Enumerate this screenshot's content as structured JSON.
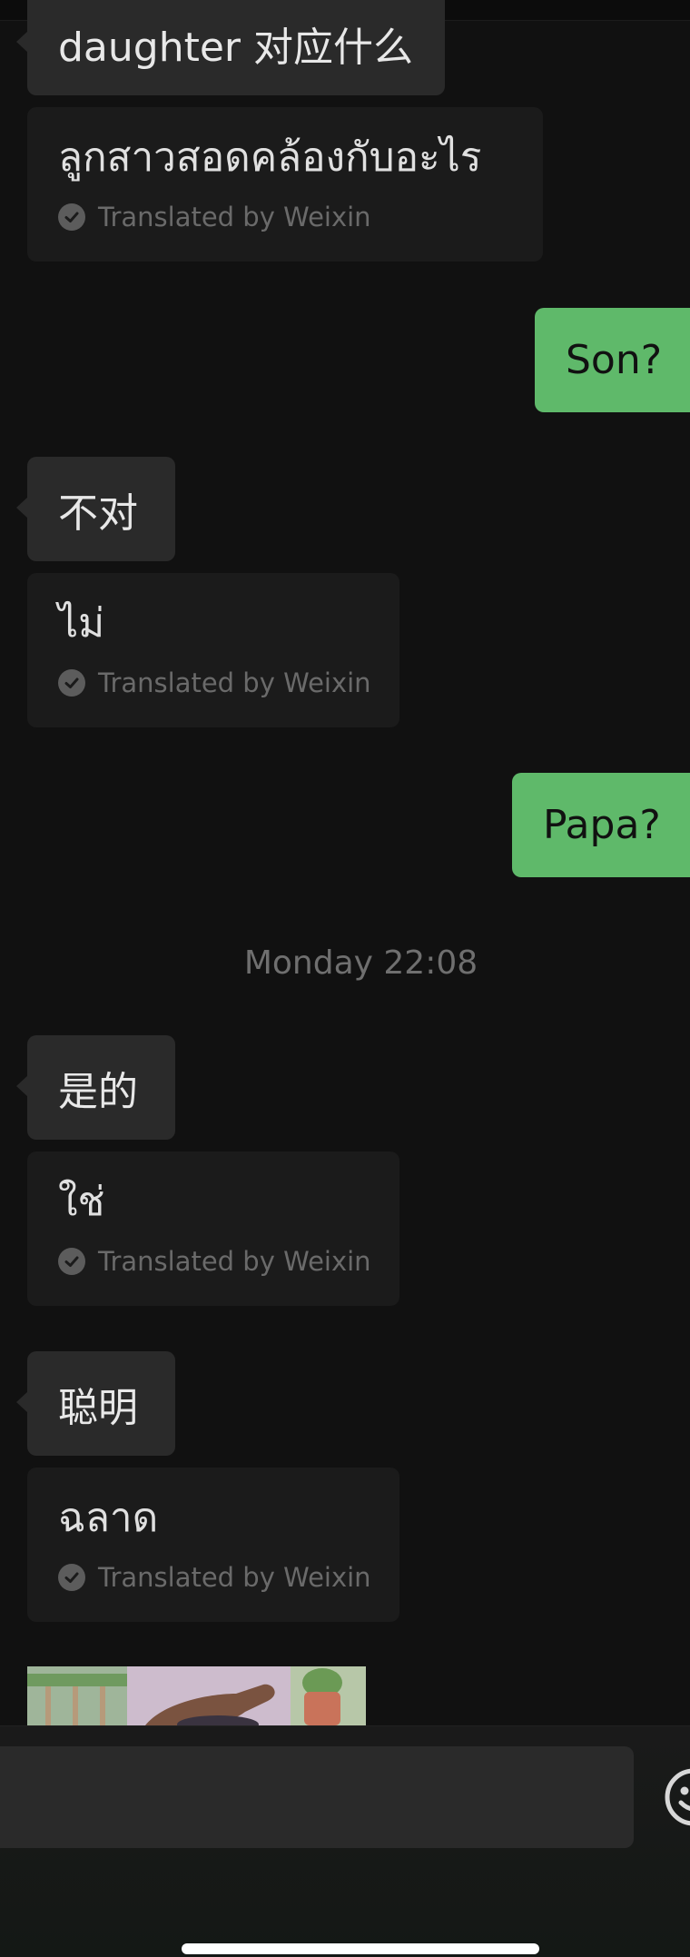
{
  "messages": [
    {
      "original": "daughter 对应什么",
      "translation": "ลูกสาวสอดคล้องกับอะไร",
      "translated_by": "Translated by Weixin"
    },
    {
      "sent": "Son?"
    },
    {
      "original": "不对",
      "translation": "ไม่",
      "translated_by": "Translated by Weixin"
    },
    {
      "sent": "Papa?"
    },
    {
      "timestamp": "Monday 22:08"
    },
    {
      "original": "是的",
      "translation": "ใช่",
      "translated_by": "Translated by Weixin"
    },
    {
      "original": "聪明",
      "translation": "ฉลาด",
      "translated_by": "Translated by Weixin"
    }
  ],
  "icons": {
    "check": "check-circle-icon",
    "emoji": "emoji-icon"
  },
  "colors": {
    "background": "#111111",
    "incoming_bubble": "#2a2a2a",
    "translation_bubble": "#1b1b1b",
    "outgoing_bubble": "#5fb96a"
  }
}
